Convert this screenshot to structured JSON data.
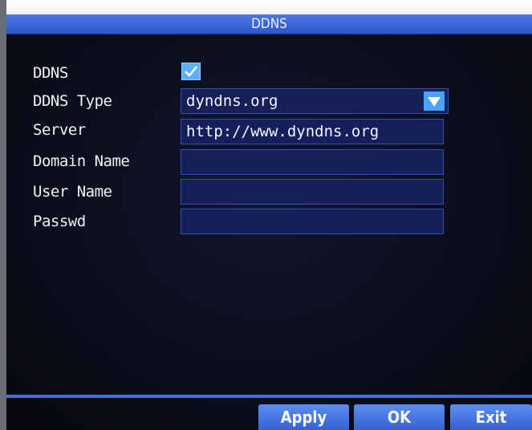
{
  "window": {
    "title": "DDNS"
  },
  "form": {
    "rows": [
      {
        "label": "DDNS"
      },
      {
        "label": "DDNS Type"
      },
      {
        "label": "Server"
      },
      {
        "label": "Domain Name"
      },
      {
        "label": "User Name"
      },
      {
        "label": "Passwd"
      }
    ],
    "ddns_enabled": true,
    "ddns_type_value": "dyndns.org",
    "server_value": "http://www.dyndns.org",
    "domain_name_value": "",
    "user_name_value": "",
    "passwd_value": ""
  },
  "buttons": {
    "apply": "Apply",
    "ok": "OK",
    "exit": "Exit"
  },
  "icons": {
    "checkbox": "check-icon",
    "dropdown": "triangle-down-icon"
  },
  "colors": {
    "accent": "#3e6ee0",
    "field_bg": "#15205a",
    "background": "#0b0d1b"
  }
}
